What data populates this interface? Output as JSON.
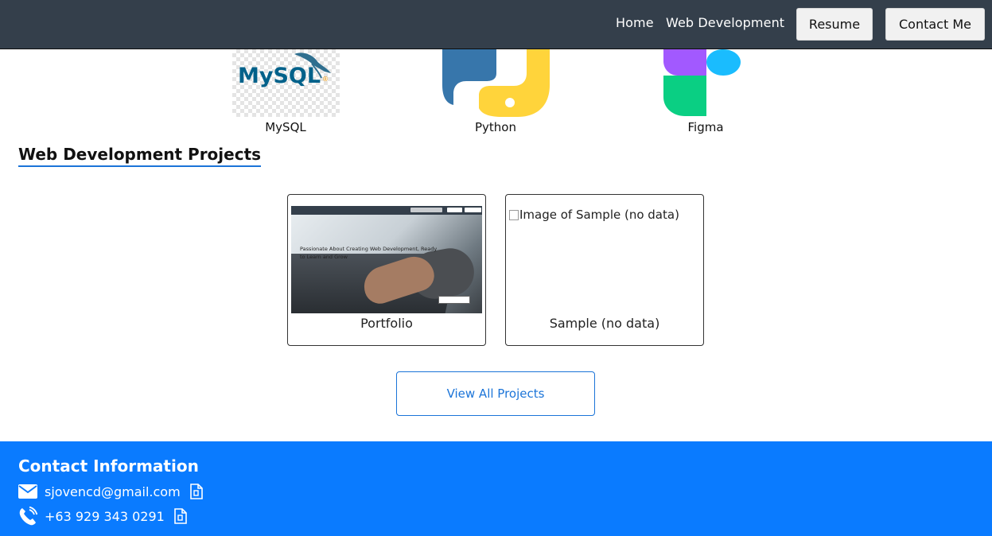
{
  "nav": {
    "links": [
      {
        "label": "Home"
      },
      {
        "label": "Web Development"
      }
    ],
    "resume_label": "Resume",
    "contact_label": "Contact Me"
  },
  "skills": [
    {
      "name": "MySQL",
      "logo_text": "MySQL",
      "icon": "mysql-logo"
    },
    {
      "name": "Python",
      "icon": "python-logo"
    },
    {
      "name": "Figma",
      "icon": "figma-logo"
    }
  ],
  "projects_section": {
    "title": "Web Development Projects",
    "projects": [
      {
        "title": "Portfolio",
        "thumbnail_text": "Passionate About Creating Web Development, Ready to Learn and Grow"
      },
      {
        "title": "Sample (no data)",
        "image_alt": "Image of Sample (no data)"
      }
    ],
    "view_all_label": "View All Projects"
  },
  "footer": {
    "title": "Contact Information",
    "email": "sjovencd@gmail.com",
    "phone": "+63 929 343 0291",
    "icons": [
      "envelope-icon",
      "phone-icon",
      "copy-icon"
    ]
  },
  "colors": {
    "navbar_bg": "#343f4b",
    "accent": "#1b74d8",
    "footer_bg": "#0a7bff"
  }
}
